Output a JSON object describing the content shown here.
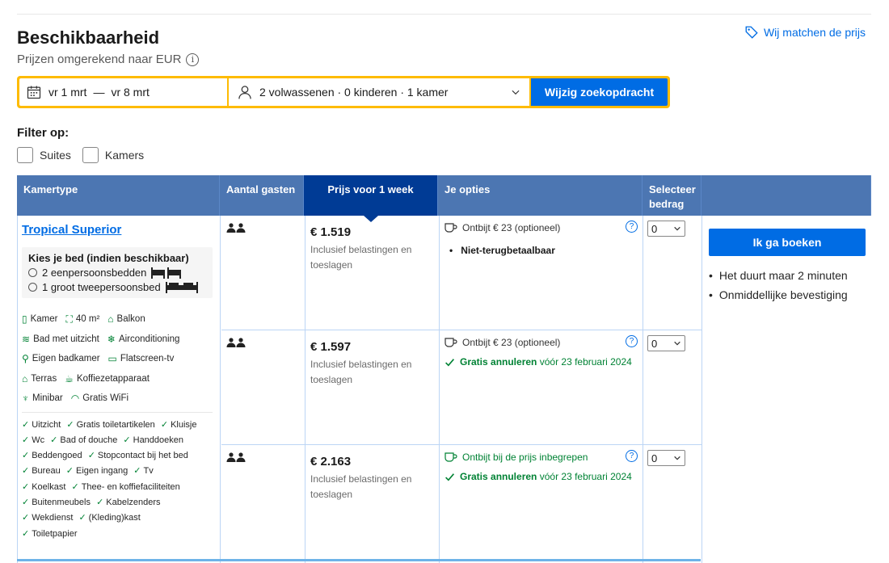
{
  "header": {
    "price_match": "Wij matchen de prijs",
    "title": "Beschikbaarheid",
    "subtitle": "Prijzen omgerekend naar EUR",
    "info_symbol": "i"
  },
  "search": {
    "checkin": "vr 1 mrt",
    "separator": "—",
    "checkout": "vr 8 mrt",
    "guests": "2 volwassenen · 0 kinderen · 1 kamer",
    "button": "Wijzig zoekopdracht"
  },
  "filter": {
    "title": "Filter op:",
    "options": [
      "Suites",
      "Kamers"
    ]
  },
  "table": {
    "headers": {
      "room_type": "Kamertype",
      "guests": "Aantal gasten",
      "price": "Prijs voor 1 week",
      "options": "Je opties",
      "select_1": "Selecteer",
      "select_2": "bedrag"
    }
  },
  "room": {
    "name": "Tropical Superior",
    "bed_title": "Kies je bed (indien beschikbaar)",
    "bed_options": [
      "2 eenpersoonsbedden",
      "1 groot tweepersoonsbed"
    ],
    "facilities": [
      [
        "Kamer",
        "40 m²",
        "Balkon"
      ],
      [
        "Bad met uitzicht",
        "Airconditioning"
      ],
      [
        "Eigen badkamer",
        "Flatscreen-tv"
      ],
      [
        "Terras",
        "Koffiezetapparaat"
      ],
      [
        "Minibar",
        "Gratis WiFi"
      ]
    ],
    "amenities": [
      "Uitzicht",
      "Gratis toiletartikelen",
      "Kluisje",
      "Wc",
      "Bad of douche",
      "Handdoeken",
      "Beddengoed",
      "Stopcontact bij het bed",
      "Bureau",
      "Eigen ingang",
      "Tv",
      "Koelkast",
      "Thee- en koffiefaciliteiten",
      "Buitenmeubels",
      "Kabelzenders",
      "Wekdienst",
      "(Kleding)kast",
      "Toiletpapier"
    ]
  },
  "rates": [
    {
      "price": "€ 1.519",
      "price_note": "Inclusief belastingen en toeslagen",
      "meal": "Ontbijt € 23 (optioneel)",
      "policy": "Niet-terugbetaalbaar",
      "select": "0"
    },
    {
      "price": "€ 1.597",
      "price_note": "Inclusief belastingen en toeslagen",
      "meal": "Ontbijt € 23 (optioneel)",
      "cancel_bold": "Gratis annuleren",
      "cancel_rest": "vóór 23 februari 2024",
      "select": "0"
    },
    {
      "price": "€ 2.163",
      "price_note": "Inclusief belastingen en toeslagen",
      "meal": "Ontbijt bij de prijs inbegrepen",
      "cancel_bold": "Gratis annuleren",
      "cancel_rest": "vóór 23 februari 2024",
      "select": "0"
    }
  ],
  "booking": {
    "button": "Ik ga boeken",
    "points": [
      "Het duurt maar 2 minuten",
      "Onmiddellijke bevestiging"
    ]
  },
  "colors": {
    "accent": "#006ce4",
    "search_border": "#febb02",
    "header_bg": "#4c76b2",
    "header_active": "#003b95",
    "green": "#008234"
  }
}
